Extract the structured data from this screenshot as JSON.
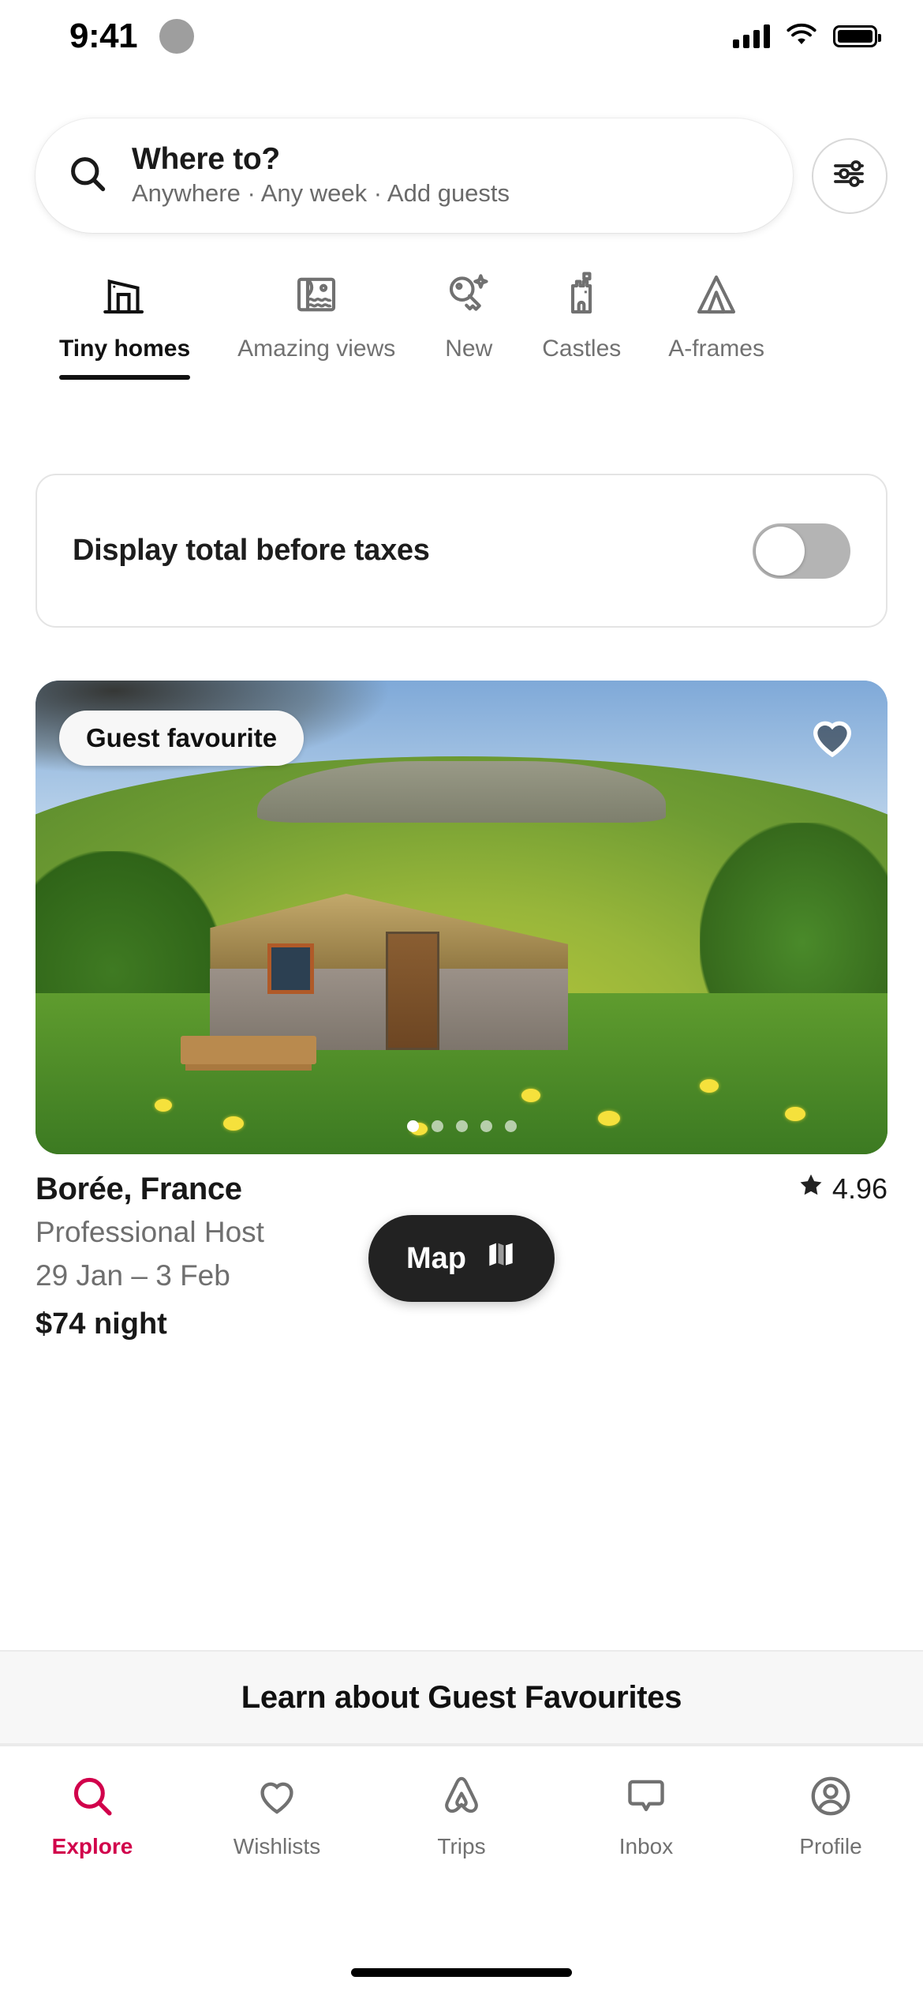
{
  "status_bar": {
    "time": "9:41",
    "cellular_icon": "signal-bars-icon",
    "wifi_icon": "wifi-icon",
    "battery_icon": "battery-full-icon"
  },
  "search": {
    "icon": "search-icon",
    "title": "Where to?",
    "subtitle": "Anywhere · Any week · Add guests",
    "placeholder": "Where to?",
    "filter_icon": "filter-sliders-icon"
  },
  "categories": [
    {
      "label": "Tiny homes",
      "icon": "tiny-home-icon",
      "active": true
    },
    {
      "label": "Amazing views",
      "icon": "amazing-views-icon",
      "active": false
    },
    {
      "label": "New",
      "icon": "key-sparkle-icon",
      "active": false
    },
    {
      "label": "Castles",
      "icon": "castle-icon",
      "active": false
    },
    {
      "label": "A-frames",
      "icon": "a-frame-icon",
      "active": false
    }
  ],
  "taxes_toggle": {
    "label": "Display total before taxes",
    "state": "off"
  },
  "listing": {
    "badge": "Guest favourite",
    "favourite_icon": "heart-icon",
    "favourited": false,
    "photo_count": 5,
    "active_photo": 1,
    "title": "Borée, France",
    "host_type": "Professional Host",
    "dates": "29 Jan – 3 Feb",
    "price": "$74 night",
    "rating": "4.96",
    "rating_icon": "star-icon"
  },
  "map_button": {
    "label": "Map",
    "icon": "map-icon"
  },
  "learn_banner": {
    "label": "Learn about Guest Favourites"
  },
  "bottom_nav": [
    {
      "label": "Explore",
      "icon": "search-icon",
      "active": true
    },
    {
      "label": "Wishlists",
      "icon": "heart-icon",
      "active": false
    },
    {
      "label": "Trips",
      "icon": "airbnb-belo-icon",
      "active": false
    },
    {
      "label": "Inbox",
      "icon": "message-bubble-icon",
      "active": false
    },
    {
      "label": "Profile",
      "icon": "user-circle-icon",
      "active": false
    }
  ],
  "colors": {
    "accent": "#D1004B",
    "text_primary": "#181818",
    "text_secondary": "#717171",
    "map_button_bg": "#222222",
    "banner_bg": "#F7F7F7"
  }
}
